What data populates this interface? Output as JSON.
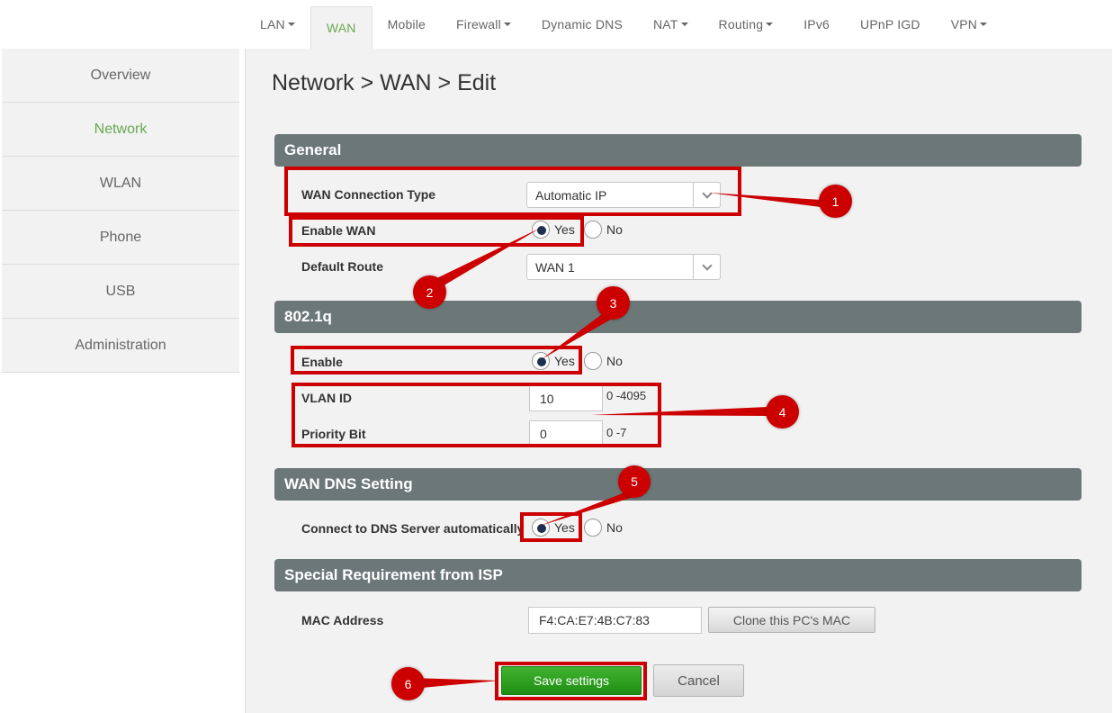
{
  "topnav": {
    "tabs": [
      {
        "label": "LAN",
        "dropdown": true
      },
      {
        "label": "WAN",
        "active": true
      },
      {
        "label": "Mobile"
      },
      {
        "label": "Firewall",
        "dropdown": true
      },
      {
        "label": "Dynamic DNS"
      },
      {
        "label": "NAT",
        "dropdown": true
      },
      {
        "label": "Routing",
        "dropdown": true
      },
      {
        "label": "IPv6"
      },
      {
        "label": "UPnP IGD"
      },
      {
        "label": "VPN",
        "dropdown": true
      }
    ]
  },
  "sidebar": {
    "items": [
      {
        "label": "Overview"
      },
      {
        "label": "Network",
        "active": true
      },
      {
        "label": "WLAN"
      },
      {
        "label": "Phone"
      },
      {
        "label": "USB"
      },
      {
        "label": "Administration"
      }
    ]
  },
  "page": {
    "title": "Network > WAN > Edit"
  },
  "general": {
    "header": "General",
    "wan_connection_type": {
      "label": "WAN Connection Type",
      "value": "Automatic IP"
    },
    "enable_wan": {
      "label": "Enable WAN",
      "yes": "Yes",
      "no": "No",
      "selected": "yes"
    },
    "default_route": {
      "label": "Default Route",
      "value": "WAN 1"
    }
  },
  "vlan": {
    "header": "802.1q",
    "enable": {
      "label": "Enable",
      "yes": "Yes",
      "no": "No",
      "selected": "yes"
    },
    "vlan_id": {
      "label": "VLAN ID",
      "value": "10",
      "hint": "0 -4095"
    },
    "priority_bit": {
      "label": "Priority Bit",
      "value": "0",
      "hint": "0 -7"
    }
  },
  "dns": {
    "header": "WAN DNS Setting",
    "auto": {
      "label": "Connect to DNS Server automatically",
      "yes": "Yes",
      "no": "No",
      "selected": "yes"
    }
  },
  "isp": {
    "header": "Special Requirement from ISP",
    "mac": {
      "label": "MAC Address",
      "value": "F4:CA:E7:4B:C7:83"
    },
    "clone_button": "Clone this PC's MAC"
  },
  "actions": {
    "save": "Save settings",
    "cancel": "Cancel"
  },
  "annotations": {
    "markers": [
      "1",
      "2",
      "3",
      "4",
      "5",
      "6"
    ],
    "color": "#cc0000"
  },
  "colors": {
    "accent_green": "#6aa84f",
    "section_bar": "#6c7878",
    "save_button": "#2ea01f"
  },
  "icons": {
    "dropdown": "chevron-down-icon",
    "tab_dropdown": "caret-down-icon"
  }
}
